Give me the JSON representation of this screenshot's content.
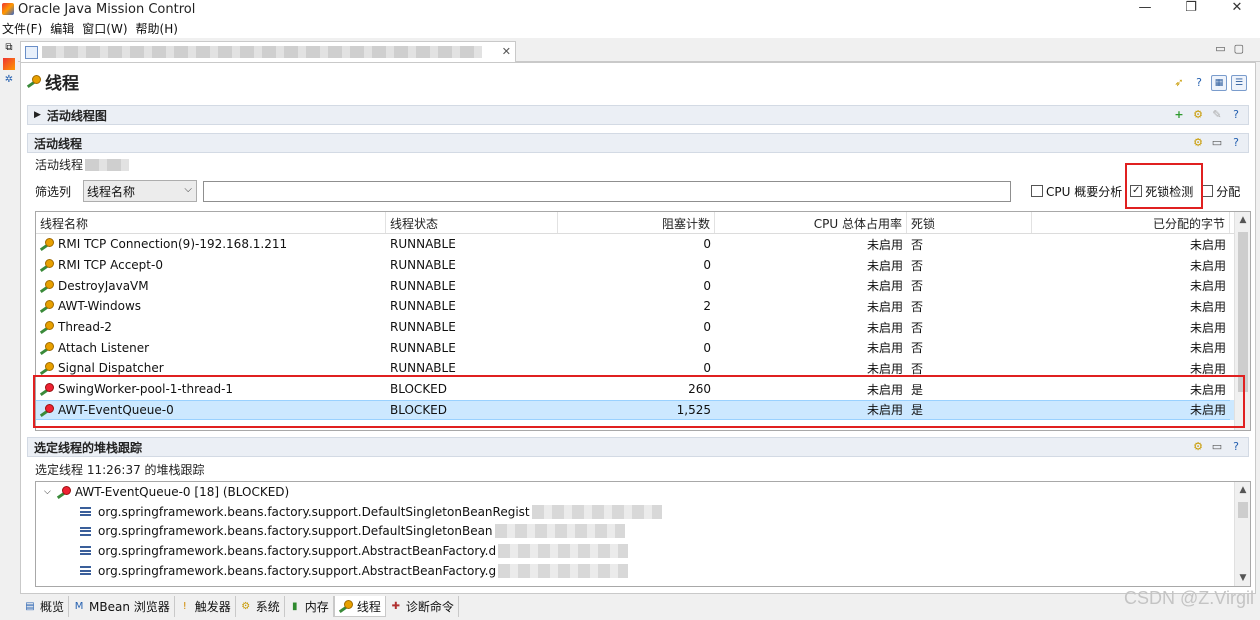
{
  "window": {
    "title": "Oracle Java Mission Control",
    "controls": [
      "—",
      "❐",
      "✕"
    ]
  },
  "menu": [
    "文件(F)",
    "编辑",
    "窗口(W)",
    "帮助(H)"
  ],
  "page": {
    "title": "线程"
  },
  "sections": {
    "graph": "活动线程图",
    "active": "活动线程",
    "active_sub": "活动线程",
    "stack": "选定线程的堆栈跟踪",
    "stack_sub": "选定线程 11:26:37 的堆栈跟踪"
  },
  "filter": {
    "label": "筛选列",
    "column": "线程名称",
    "value": "",
    "checkboxes": [
      {
        "label": "CPU 概要分析",
        "checked": false
      },
      {
        "label": "死锁检测",
        "checked": true
      },
      {
        "label": "分配",
        "checked": false
      }
    ]
  },
  "table": {
    "headers": [
      "线程名称",
      "线程状态",
      "阻塞计数",
      "CPU 总体占用率",
      "死锁",
      "已分配的字节"
    ],
    "rows": [
      {
        "name": "RMI TCP Connection(9)-192.168.1.211",
        "state": "RUNNABLE",
        "blocked": "0",
        "cpu": "未启用",
        "deadlock": "否",
        "alloc": "未启用",
        "status": "running"
      },
      {
        "name": "RMI TCP Accept-0",
        "state": "RUNNABLE",
        "blocked": "0",
        "cpu": "未启用",
        "deadlock": "否",
        "alloc": "未启用",
        "status": "running"
      },
      {
        "name": "DestroyJavaVM",
        "state": "RUNNABLE",
        "blocked": "0",
        "cpu": "未启用",
        "deadlock": "否",
        "alloc": "未启用",
        "status": "running"
      },
      {
        "name": "AWT-Windows",
        "state": "RUNNABLE",
        "blocked": "2",
        "cpu": "未启用",
        "deadlock": "否",
        "alloc": "未启用",
        "status": "running"
      },
      {
        "name": "Thread-2",
        "state": "RUNNABLE",
        "blocked": "0",
        "cpu": "未启用",
        "deadlock": "否",
        "alloc": "未启用",
        "status": "running"
      },
      {
        "name": "Attach Listener",
        "state": "RUNNABLE",
        "blocked": "0",
        "cpu": "未启用",
        "deadlock": "否",
        "alloc": "未启用",
        "status": "running"
      },
      {
        "name": "Signal Dispatcher",
        "state": "RUNNABLE",
        "blocked": "0",
        "cpu": "未启用",
        "deadlock": "否",
        "alloc": "未启用",
        "status": "running"
      },
      {
        "name": "SwingWorker-pool-1-thread-1",
        "state": "BLOCKED",
        "blocked": "260",
        "cpu": "未启用",
        "deadlock": "是",
        "alloc": "未启用",
        "status": "blocked"
      },
      {
        "name": "AWT-EventQueue-0",
        "state": "BLOCKED",
        "blocked": "1,525",
        "cpu": "未启用",
        "deadlock": "是",
        "alloc": "未启用",
        "status": "blocked",
        "selected": true
      }
    ]
  },
  "stack": {
    "root": "AWT-EventQueue-0 [18] (BLOCKED)",
    "frames": [
      "org.springframework.beans.factory.support.DefaultSingletonBeanRegist",
      "org.springframework.beans.factory.support.DefaultSingletonBean",
      "org.springframework.beans.factory.support.AbstractBeanFactory.d",
      "org.springframework.beans.factory.support.AbstractBeanFactory.g"
    ]
  },
  "bottom_tabs": [
    {
      "label": "概览",
      "icon": "overview-icon"
    },
    {
      "label": "MBean 浏览器",
      "icon": "mbean-icon"
    },
    {
      "label": "触发器",
      "icon": "trigger-icon"
    },
    {
      "label": "系统",
      "icon": "system-icon"
    },
    {
      "label": "内存",
      "icon": "memory-icon"
    },
    {
      "label": "线程",
      "icon": "thread-icon",
      "active": true
    },
    {
      "label": "诊断命令",
      "icon": "diagnostic-icon"
    }
  ],
  "watermark": "CSDN @Z.Virgil",
  "colors": {
    "highlight": "#e02020",
    "selection": "#cce8ff",
    "section": "#ebeff5"
  }
}
